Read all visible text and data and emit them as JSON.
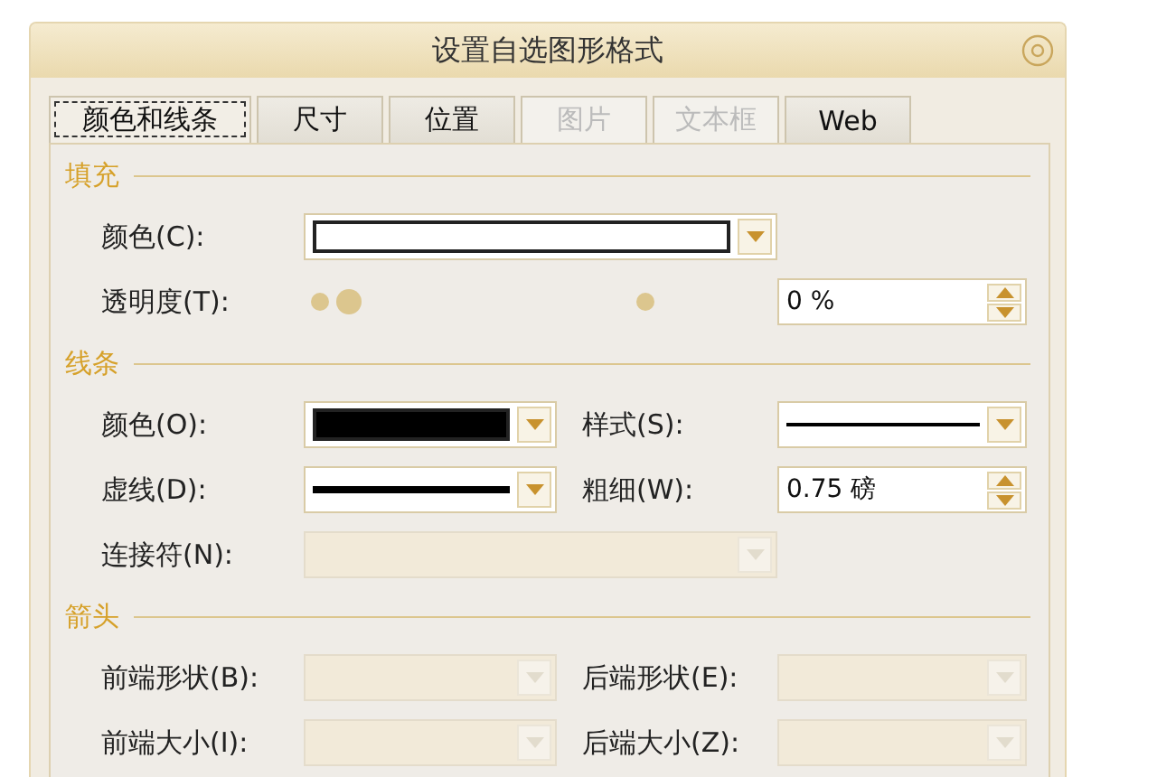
{
  "window": {
    "title": "设置自选图形格式"
  },
  "tabs": [
    {
      "label": "颜色和线条",
      "selected": true,
      "disabled": false
    },
    {
      "label": "尺寸",
      "selected": false,
      "disabled": false
    },
    {
      "label": "位置",
      "selected": false,
      "disabled": false
    },
    {
      "label": "图片",
      "selected": false,
      "disabled": true
    },
    {
      "label": "文本框",
      "selected": false,
      "disabled": true
    },
    {
      "label": "Web",
      "selected": false,
      "disabled": false
    }
  ],
  "sections": [
    {
      "title": "填充",
      "rows": [
        {
          "fields": [
            {
              "label": "颜色(C):",
              "kind": "color",
              "color": "#ffffff",
              "disabled": false
            }
          ]
        },
        {
          "fields": [
            {
              "label": "透明度(T):",
              "kind": "slider",
              "level": 0
            },
            {
              "kind": "spinner",
              "value": "0 %"
            }
          ]
        }
      ]
    },
    {
      "title": "线条",
      "rows": [
        {
          "fields": [
            {
              "label": "颜色(O):",
              "kind": "color",
              "color": "#000000",
              "disabled": false
            },
            {
              "label": "样式(S):",
              "kind": "line-style",
              "disabled": false
            }
          ]
        },
        {
          "fields": [
            {
              "label": "虚线(D):",
              "kind": "dash-style",
              "disabled": false
            },
            {
              "label": "粗细(W):",
              "kind": "spinner",
              "value": "0.75 磅"
            }
          ]
        },
        {
          "fields": [
            {
              "label": "连接符(N):",
              "kind": "dropdown",
              "disabled": true
            }
          ]
        }
      ]
    },
    {
      "title": "箭头",
      "rows": [
        {
          "fields": [
            {
              "label": "前端形状(B):",
              "kind": "dropdown",
              "disabled": true
            },
            {
              "label": "后端形状(E):",
              "kind": "dropdown",
              "disabled": true
            }
          ]
        },
        {
          "fields": [
            {
              "label": "前端大小(I):",
              "kind": "dropdown",
              "disabled": true
            },
            {
              "label": "后端大小(Z):",
              "kind": "dropdown",
              "disabled": true
            }
          ]
        }
      ]
    }
  ]
}
